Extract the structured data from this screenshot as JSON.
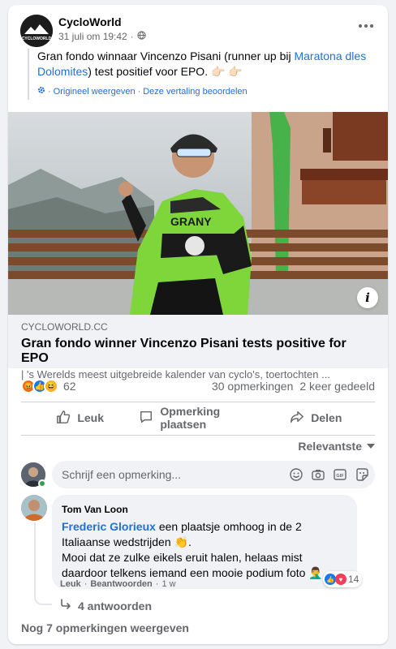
{
  "post": {
    "page_name": "CycloWorld",
    "avatar_text": "CYCLOWORLD",
    "date": "31 juli om 19:42",
    "dot": "·",
    "privacy_icon": "globe-icon",
    "text_before": "Gran fondo winnaar Vincenzo Pisani (runner up bij ",
    "text_link": "Maratona dles Dolomites",
    "text_after": ") test positief voor EPO. 👉🏻 👉🏻",
    "show_original": "Origineel weergeven",
    "rate_translation": "Deze vertaling beoordelen",
    "translate_sep": "·"
  },
  "link_preview": {
    "domain": "CYCLOWORLD.CC",
    "title": "Gran fondo winner Vincenzo Pisani tests positive for EPO",
    "description": "| 's Werelds meest uitgebreide kalender van cyclo's, toertochten ...",
    "info_label": "i",
    "image_jersey_text": "GRANY"
  },
  "stats": {
    "reaction_count": "62",
    "comments": "30 opmerkingen",
    "shares": "2 keer gedeeld",
    "reactions": [
      "angry",
      "like",
      "haha"
    ]
  },
  "actions": {
    "like": "Leuk",
    "comment": "Opmerking plaatsen",
    "share": "Delen"
  },
  "sort": {
    "label": "Relevantste"
  },
  "composer": {
    "placeholder": "Schrijf een opmerking..."
  },
  "comment": {
    "author": "Tom Van Loon",
    "mention": "Frederic Glorieux",
    "text_1": " een plaatsje omhoog in de 2 Italiaanse wedstrijden 👏.",
    "text_2": "Mooi dat ze zulke eikels eruit halen, helaas mist daardoor telkens iemand een mooie podium foto 🤦‍♂️",
    "like": "Leuk",
    "reply": "Beantwoorden",
    "time": "1 w",
    "sep": "·",
    "reaction_count": "14",
    "replies": "4 antwoorden"
  },
  "more_comments": "Nog 7 opmerkingen weergeven",
  "colors": {
    "link": "#216fdb",
    "secondary": "#65676b",
    "jersey_green": "#7fd63a"
  }
}
